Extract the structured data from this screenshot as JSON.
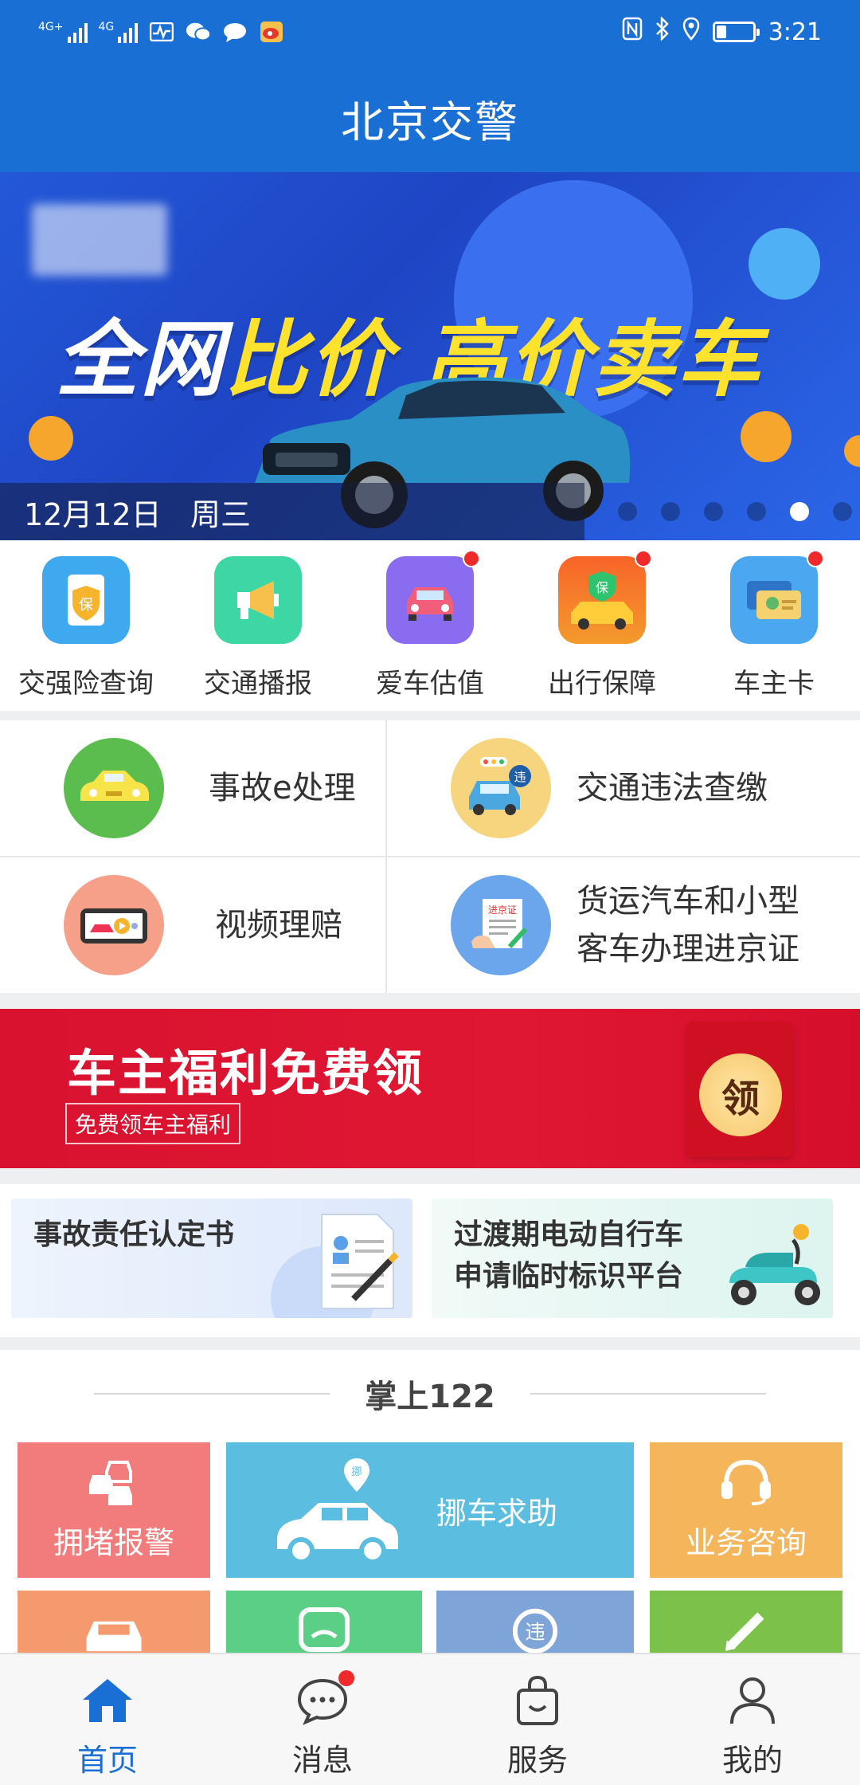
{
  "status_bar": {
    "network1": "4G+",
    "network2": "4G",
    "time": "3:21"
  },
  "header": {
    "title": "北京交警"
  },
  "banner": {
    "headline_part1": "全网",
    "headline_part2": "比价",
    "headline_part3": " 高价卖车",
    "date": "12月12日",
    "weekday": "周三",
    "slides_total": 6,
    "active_slide": 5
  },
  "quick_icons": [
    {
      "label": "交强险查询",
      "icon": "insurance-shield-icon",
      "color": "#3fa9f0",
      "badge": false
    },
    {
      "label": "交通播报",
      "icon": "megaphone-icon",
      "color": "#3ed6a4",
      "badge": false
    },
    {
      "label": "爱车估值",
      "icon": "car-front-icon",
      "color": "#8a6cf0",
      "badge": true
    },
    {
      "label": "出行保障",
      "icon": "car-protection-icon",
      "color": "#f47b26",
      "badge": true
    },
    {
      "label": "车主卡",
      "icon": "card-icon",
      "color": "#4aa7f0",
      "badge": true
    }
  ],
  "services": [
    {
      "label": "事故e处理",
      "icon": "yellow-car-icon"
    },
    {
      "label": "交通违法查缴",
      "icon": "traffic-violation-icon"
    },
    {
      "label": "视频理赔",
      "icon": "video-claim-icon"
    },
    {
      "label_line1": "货运汽车和小型",
      "label_line2": "客车办理进京证",
      "icon": "beijing-permit-icon"
    }
  ],
  "promo": {
    "title": "车主福利免费领",
    "subtitle": "免费领车主福利",
    "seal_char": "领"
  },
  "cards": [
    {
      "text": "事故责任认定书"
    },
    {
      "line1": "过渡期电动自行车",
      "line2": "申请临时标识平台"
    }
  ],
  "section_122": {
    "title": "掌上122",
    "tiles": [
      {
        "label": "拥堵报警",
        "color": "#f27c7c"
      },
      {
        "label": "挪车求助",
        "color": "#5bbde0",
        "pin": "挪"
      },
      {
        "label": "业务咨询",
        "color": "#f5b55a"
      }
    ],
    "row2_colors": [
      "#f59a6e",
      "#5ccf86",
      "#7fa4d8",
      "#7cc24a"
    ],
    "row2_badge": "违"
  },
  "bottom_nav": [
    {
      "label": "首页",
      "active": true
    },
    {
      "label": "消息",
      "active": false,
      "badge": true
    },
    {
      "label": "服务",
      "active": false
    },
    {
      "label": "我的",
      "active": false
    }
  ]
}
